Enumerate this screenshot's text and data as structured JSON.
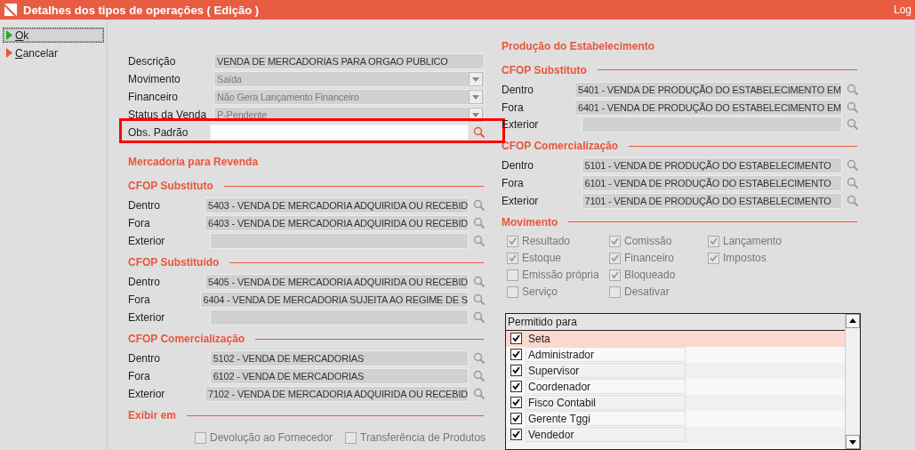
{
  "window": {
    "title": "Detalhes dos tipos de operações ( Edição )",
    "log": "Log"
  },
  "actions": [
    {
      "label": "Ok",
      "kind": "ok",
      "focused": true
    },
    {
      "label": "Cancelar",
      "kind": "cancel",
      "focused": false
    }
  ],
  "general": [
    {
      "label": "Descrição",
      "value": "VENDA DE MERCADORIAS PARA ORGAO PUBLICO",
      "kind": "text",
      "highlighted": false
    },
    {
      "label": "Movimento",
      "value": "Saída",
      "kind": "select",
      "disabled": true,
      "highlighted": false
    },
    {
      "label": "Financeiro",
      "value": "Não Gera Lançamento Financeiro",
      "kind": "select",
      "disabled": true,
      "highlighted": false
    },
    {
      "label": "Status da Venda",
      "value": "P-Pendente",
      "kind": "select",
      "disabled": true,
      "highlighted": false
    },
    {
      "label": "Obs. Padrão",
      "kind": "search",
      "highlighted": true
    }
  ],
  "left_title": "Mercadoria para Revenda",
  "left_groups": [
    {
      "title": "CFOP Substituto",
      "rows": [
        {
          "label": "Dentro",
          "value": "5403 - VENDA DE MERCADORIA ADQUIRIDA OU RECEBID"
        },
        {
          "label": "Fora",
          "value": "6403 - VENDA DE MERCADORIA ADQUIRIDA OU RECEBID"
        },
        {
          "label": "Exterior"
        }
      ]
    },
    {
      "title": "CFOP Substituído",
      "rows": [
        {
          "label": "Dentro",
          "value": "5405 - VENDA DE MERCADORIA ADQUIRIDA OU RECEBID"
        },
        {
          "label": "Fora",
          "value": "6404 - VENDA DE MERCADORIA SUJEITA AO REGIME DE S"
        },
        {
          "label": "Exterior"
        }
      ]
    },
    {
      "title": "CFOP Comercialização",
      "rows": [
        {
          "label": "Dentro",
          "value": "5102 - VENDA DE MERCADORIAS"
        },
        {
          "label": "Fora",
          "value": "6102 - VENDA DE MERCADORIAS"
        },
        {
          "label": "Exterior",
          "value": "7102 - VENDA DE MERCADORIA ADQUIRIDA OU RECEBID"
        }
      ]
    }
  ],
  "exibir": {
    "title": "Exibir em",
    "options": [
      {
        "label": "Devolução ao Fornecedor",
        "checked": false
      },
      {
        "label": "Transferência de Produtos",
        "checked": false
      }
    ]
  },
  "right_title": "Produção do Estabelecimento",
  "right_groups": [
    {
      "title": "CFOP Substituto",
      "rows": [
        {
          "label": "Dentro",
          "value": "5401 - VENDA DE PRODUÇÃO DO ESTABELECIMENTO EM"
        },
        {
          "label": "Fora",
          "value": "6401 - VENDA DE PRODUÇÃO DO ESTABELECIMENTO EM"
        },
        {
          "label": "Exterior"
        }
      ]
    },
    {
      "title": "CFOP Comercialização",
      "rows": [
        {
          "label": "Dentro",
          "value": "5101 - VENDA DE PRODUÇÃO DO ESTABELECIMENTO"
        },
        {
          "label": "Fora",
          "value": "6101 - VENDA DE PRODUÇÃO DO ESTABELECIMENTO"
        },
        {
          "label": "Exterior",
          "value": "7101 - VENDA DE PRODUÇÃO DO ESTABELECIMENTO"
        }
      ]
    }
  ],
  "movimento": {
    "title": "Movimento",
    "options": [
      {
        "label": "Resultado",
        "checked": true
      },
      {
        "label": "Estoque",
        "checked": true
      },
      {
        "label": "Emissão própria",
        "checked": false
      },
      {
        "label": "Serviço",
        "checked": false
      },
      {
        "label": "Comissão",
        "checked": true
      },
      {
        "label": "Financeiro",
        "checked": true
      },
      {
        "label": "Bloqueado",
        "checked": true
      },
      {
        "label": "Desativar",
        "checked": false
      },
      {
        "label": "Lançamento",
        "checked": true
      },
      {
        "label": "Impostos",
        "checked": true
      }
    ]
  },
  "permitido": {
    "header": "Permitido para",
    "rows": [
      {
        "label": "Seta",
        "checked": true,
        "selected": true
      },
      {
        "label": "Administrador",
        "checked": true,
        "selected": false
      },
      {
        "label": "Supervisor",
        "checked": true,
        "selected": false
      },
      {
        "label": "Coordenador",
        "checked": true,
        "selected": false
      },
      {
        "label": "Fisco Contabil",
        "checked": true,
        "selected": false
      },
      {
        "label": "Gerente Tggi",
        "checked": true,
        "selected": false
      },
      {
        "label": "Vendedor",
        "checked": true,
        "selected": false
      }
    ]
  }
}
